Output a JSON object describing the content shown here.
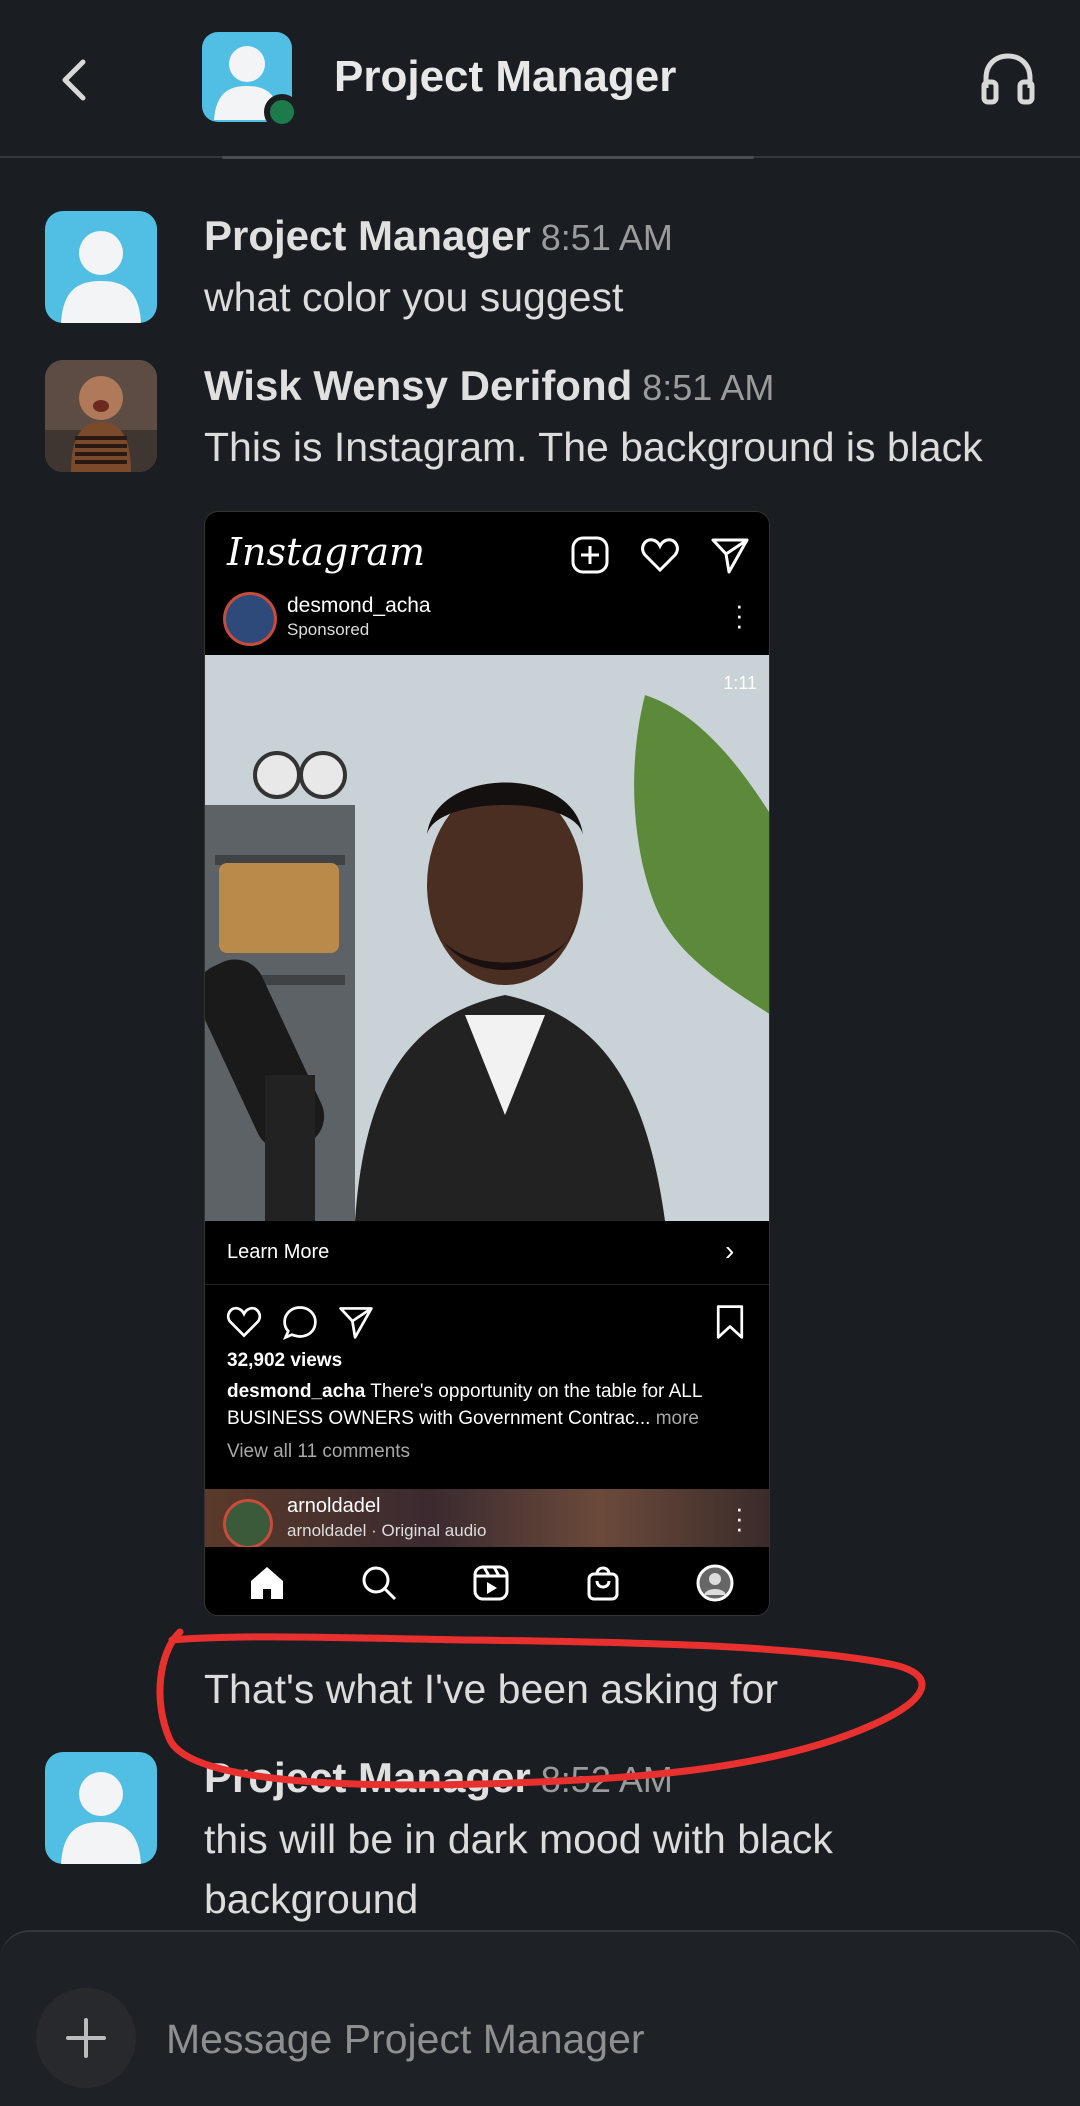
{
  "header": {
    "title": "Project Manager",
    "back_icon": "chevron-left-icon",
    "call_icon": "headphones-icon",
    "presence_color": "#1d7a4a"
  },
  "messages": [
    {
      "sender": "Project Manager",
      "time": "8:51 AM",
      "text": "what color you suggest"
    },
    {
      "sender": "Wisk Wensy Derifond",
      "time": "8:51 AM",
      "text": "This is Instagram. The background is black",
      "followup": "That's what I've been asking for"
    },
    {
      "sender": "Project Manager",
      "time": "8:52 AM",
      "text_lines": [
        "this will be in dark mood with black",
        "background"
      ]
    }
  ],
  "instagram": {
    "logo": "Instagram",
    "username": "desmond_acha",
    "sponsored": "Sponsored",
    "video_time": "1:11",
    "learn_more": "Learn More",
    "views": "32,902 views",
    "caption_user": "desmond_acha",
    "caption": "There's opportunity on the table for ALL BUSINESS OWNERS with Government Contrac...",
    "more": "more",
    "comments": "View all 11 comments",
    "next_user": "arnoldadel",
    "next_sub": "arnoldadel · Original audio"
  },
  "composer": {
    "placeholder": "Message Project Manager"
  },
  "colors": {
    "background": "#1a1d21",
    "avatar": "#50bfe3",
    "annotation": "#e8312f"
  }
}
